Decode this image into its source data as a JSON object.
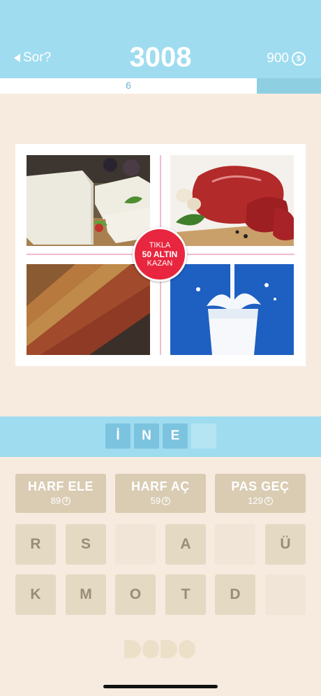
{
  "header": {
    "back_label": "Sor?",
    "score": "3008",
    "coins": "900",
    "coin_symbol": "$"
  },
  "progress": {
    "level": "6",
    "fraction": 0.8
  },
  "puzzle": {
    "images": [
      "cheese",
      "meat",
      "leather",
      "milk"
    ],
    "badge_line1": "TIKLA",
    "badge_line2": "50 ALTIN",
    "badge_line3": "KAZAN"
  },
  "answer": {
    "slots": [
      "İ",
      "N",
      "E",
      ""
    ]
  },
  "actions": [
    {
      "label": "HARF ELE",
      "price": "89"
    },
    {
      "label": "HARF AÇ",
      "price": "59"
    },
    {
      "label": "PAS GEÇ",
      "price": "129"
    }
  ],
  "keyboard": {
    "row1": [
      "R",
      "S",
      "",
      "A",
      "",
      "Ü"
    ],
    "row2": [
      "K",
      "M",
      "O",
      "T",
      "D",
      ""
    ]
  },
  "colors": {
    "header": "#9fdcef",
    "badge": "#e8263f",
    "key": "#e4d9c3",
    "background": "#f7ebe0"
  }
}
